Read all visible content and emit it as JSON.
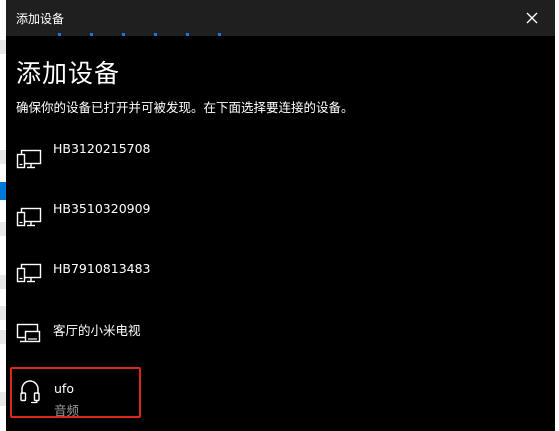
{
  "window": {
    "title": "添加设备",
    "close_icon": "close-icon"
  },
  "page": {
    "heading": "添加设备",
    "subtitle": "确保你的设备已打开并可被发现。在下面选择要连接的设备。"
  },
  "devices": [
    {
      "name": "HB3120215708",
      "icon": "display-device-icon"
    },
    {
      "name": "HB3510320909",
      "icon": "display-device-icon"
    },
    {
      "name": "HB7910813483",
      "icon": "display-device-icon"
    },
    {
      "name": "客厅的小米电视",
      "icon": "tv-device-icon"
    }
  ],
  "selected_device": {
    "name": "ufo",
    "type": "音频",
    "icon": "headphones-icon",
    "highlight_color": "#e0261a"
  },
  "colors": {
    "background": "#000000",
    "titlebar": "#1f1f1f",
    "accent": "#1976d2"
  }
}
